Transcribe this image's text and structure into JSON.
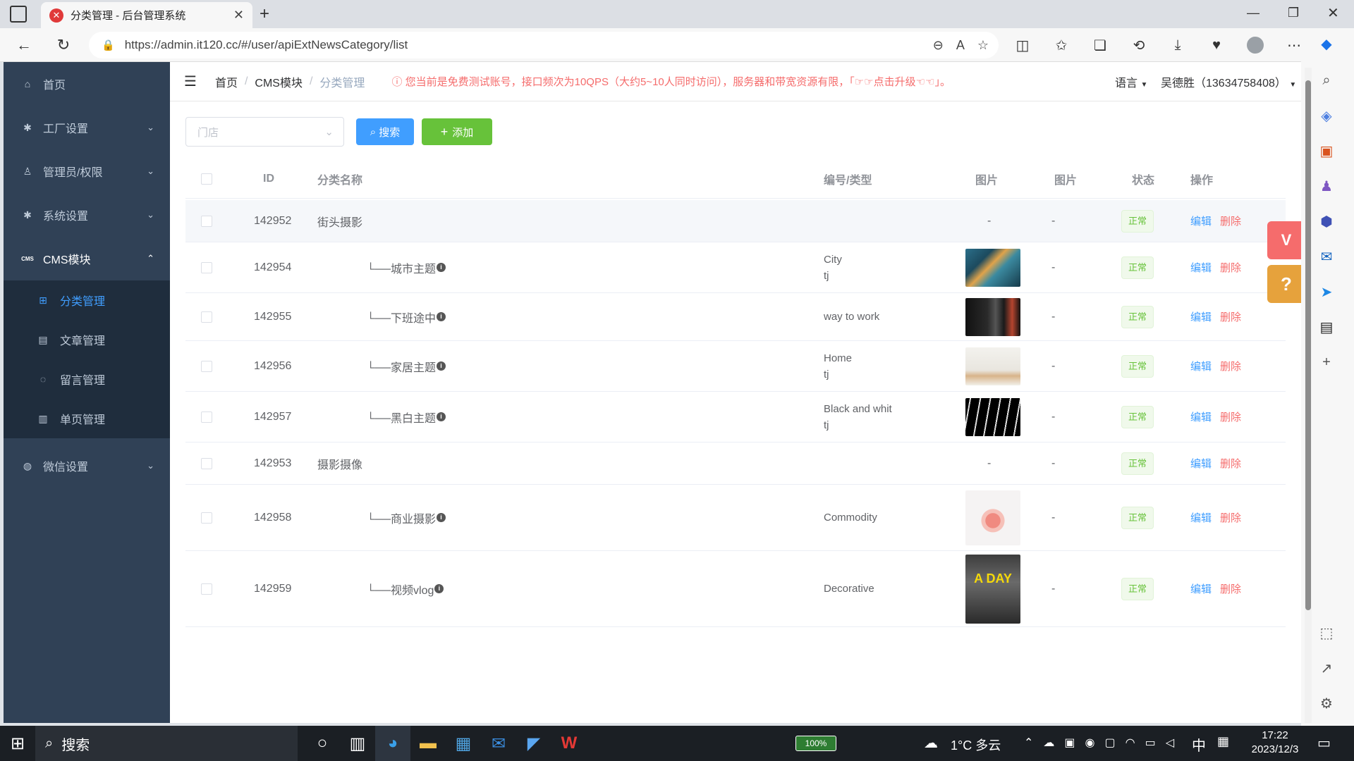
{
  "browser": {
    "tab_title": "分类管理 - 后台管理系统",
    "tab_favicon": "✕",
    "url": "https://admin.it120.cc/#/user/apiExtNewsCategory/list"
  },
  "sidebar": {
    "items": [
      {
        "label": "首页",
        "icon": "home-icon"
      },
      {
        "label": "工厂设置",
        "icon": "gear-icon"
      },
      {
        "label": "管理员/权限",
        "icon": "user-key-icon"
      },
      {
        "label": "系统设置",
        "icon": "gear-icon"
      },
      {
        "label": "CMS模块",
        "icon": "cms-icon",
        "icon_text": "CMS"
      },
      {
        "label": "微信设置",
        "icon": "wechat-icon"
      }
    ],
    "cms_sub": [
      {
        "label": "分类管理",
        "active": true
      },
      {
        "label": "文章管理"
      },
      {
        "label": "留言管理"
      },
      {
        "label": "单页管理"
      }
    ]
  },
  "navbar": {
    "breadcrumb": [
      "首页",
      "CMS模块",
      "分类管理"
    ],
    "warning": "ⓘ 您当前是免费测试账号，接口频次为10QPS（大约5~10人同时访问），服务器和带宽资源有限，「☞☞点击升级☜☜」。",
    "lang_label": "语言",
    "user_label": "吴德胜（13634758408）"
  },
  "filter": {
    "store_placeholder": "门店",
    "search_label": "搜索",
    "add_label": "添加"
  },
  "table": {
    "headers": [
      "ID",
      "分类名称",
      "编号/类型",
      "图片",
      "图片",
      "状态",
      "操作"
    ],
    "edit_label": "编辑",
    "delete_label": "删除",
    "rows": [
      {
        "id": "142952",
        "name": "街头摄影",
        "child": false,
        "code": "",
        "type": "",
        "img": "-",
        "img2": "-",
        "status": "正常"
      },
      {
        "id": "142954",
        "name": "└──城市主题",
        "child": true,
        "code": "City",
        "type": "tj",
        "img": "city",
        "img2": "-",
        "status": "正常"
      },
      {
        "id": "142955",
        "name": "└──下班途中",
        "child": true,
        "code": "way to work",
        "type": "",
        "img": "work",
        "img2": "-",
        "status": "正常"
      },
      {
        "id": "142956",
        "name": "└──家居主题",
        "child": true,
        "code": "Home",
        "type": "tj",
        "img": "home",
        "img2": "-",
        "status": "正常"
      },
      {
        "id": "142957",
        "name": "└──黑白主题",
        "child": true,
        "code": "Black and whit",
        "type": "tj",
        "img": "bw",
        "img2": "-",
        "status": "正常"
      },
      {
        "id": "142953",
        "name": "摄影摄像",
        "child": false,
        "code": "",
        "type": "",
        "img": "-",
        "img2": "-",
        "status": "正常"
      },
      {
        "id": "142958",
        "name": "└──商业摄影",
        "child": true,
        "code": "Commodity",
        "type": "",
        "img": "commodity",
        "img2": "-",
        "status": "正常"
      },
      {
        "id": "142959",
        "name": "└──视频vlog",
        "child": true,
        "code": "Decorative",
        "type": "",
        "img": "vlog",
        "img2": "-",
        "status": "正常"
      }
    ]
  },
  "vlog_thumb_text": "A DAY",
  "taskbar": {
    "search_label": "搜索",
    "battery": "100%",
    "weather": "1°C 多云",
    "ime": "中",
    "time": "17:22",
    "date": "2023/12/3"
  },
  "colors": {
    "sidebar": "#304156",
    "primary": "#409eff",
    "success": "#67c23a",
    "danger": "#f56c6c"
  }
}
